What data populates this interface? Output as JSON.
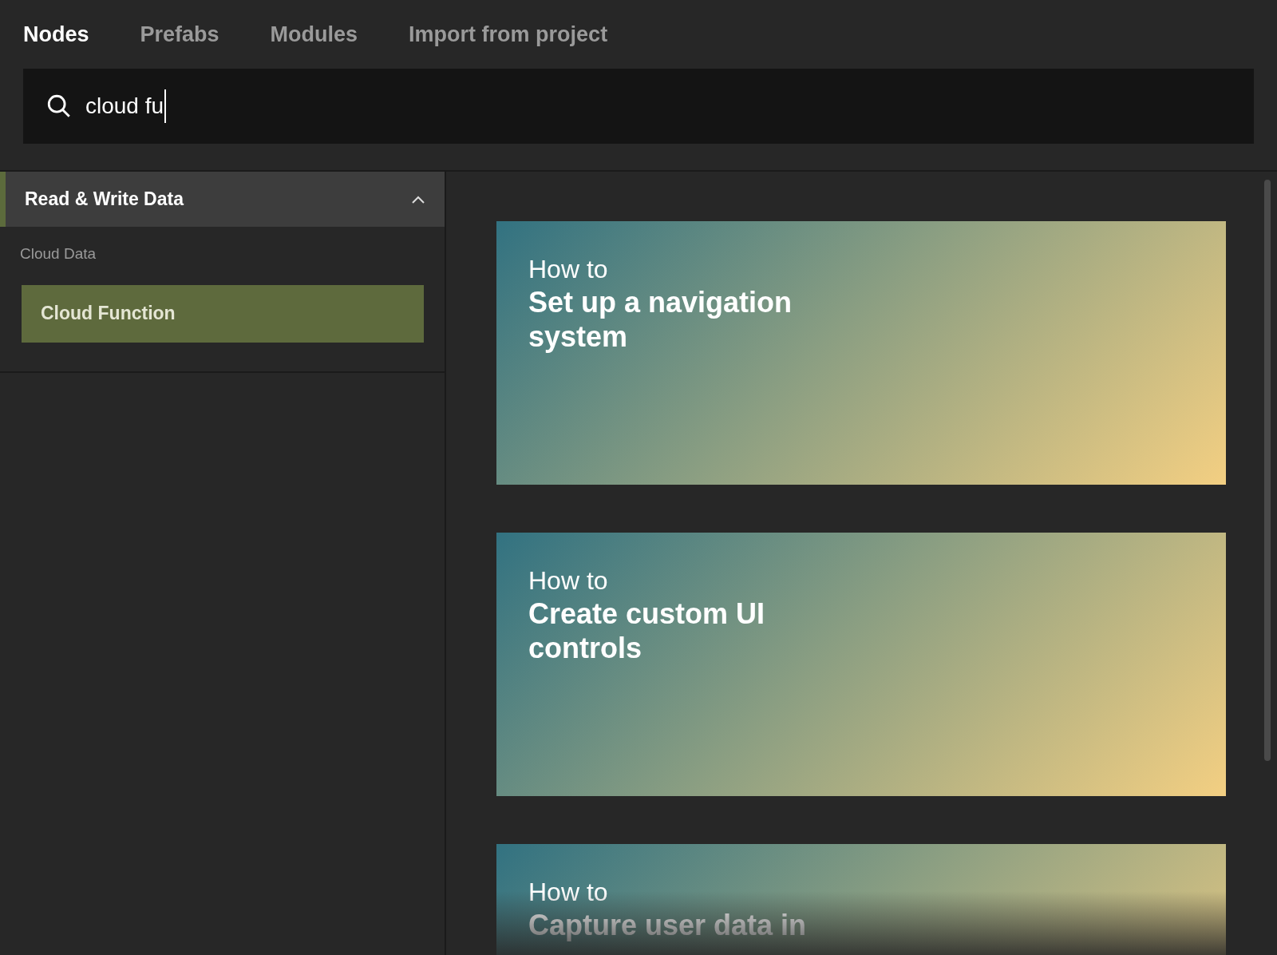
{
  "tabs": [
    {
      "label": "Nodes",
      "selected": true
    },
    {
      "label": "Prefabs",
      "selected": false
    },
    {
      "label": "Modules",
      "selected": false
    },
    {
      "label": "Import from project",
      "selected": false
    }
  ],
  "search": {
    "value": "cloud fu"
  },
  "sidebar": {
    "group": {
      "label": "Read & Write Data",
      "expanded": true
    },
    "section": "Cloud Data",
    "items": [
      {
        "label": "Cloud Function",
        "selected": true
      }
    ]
  },
  "cards": [
    {
      "prefix": "How to",
      "title": "Set up a navigation system"
    },
    {
      "prefix": "How to",
      "title": "Create custom UI controls"
    },
    {
      "prefix": "How to",
      "title": "Capture user data in"
    }
  ]
}
